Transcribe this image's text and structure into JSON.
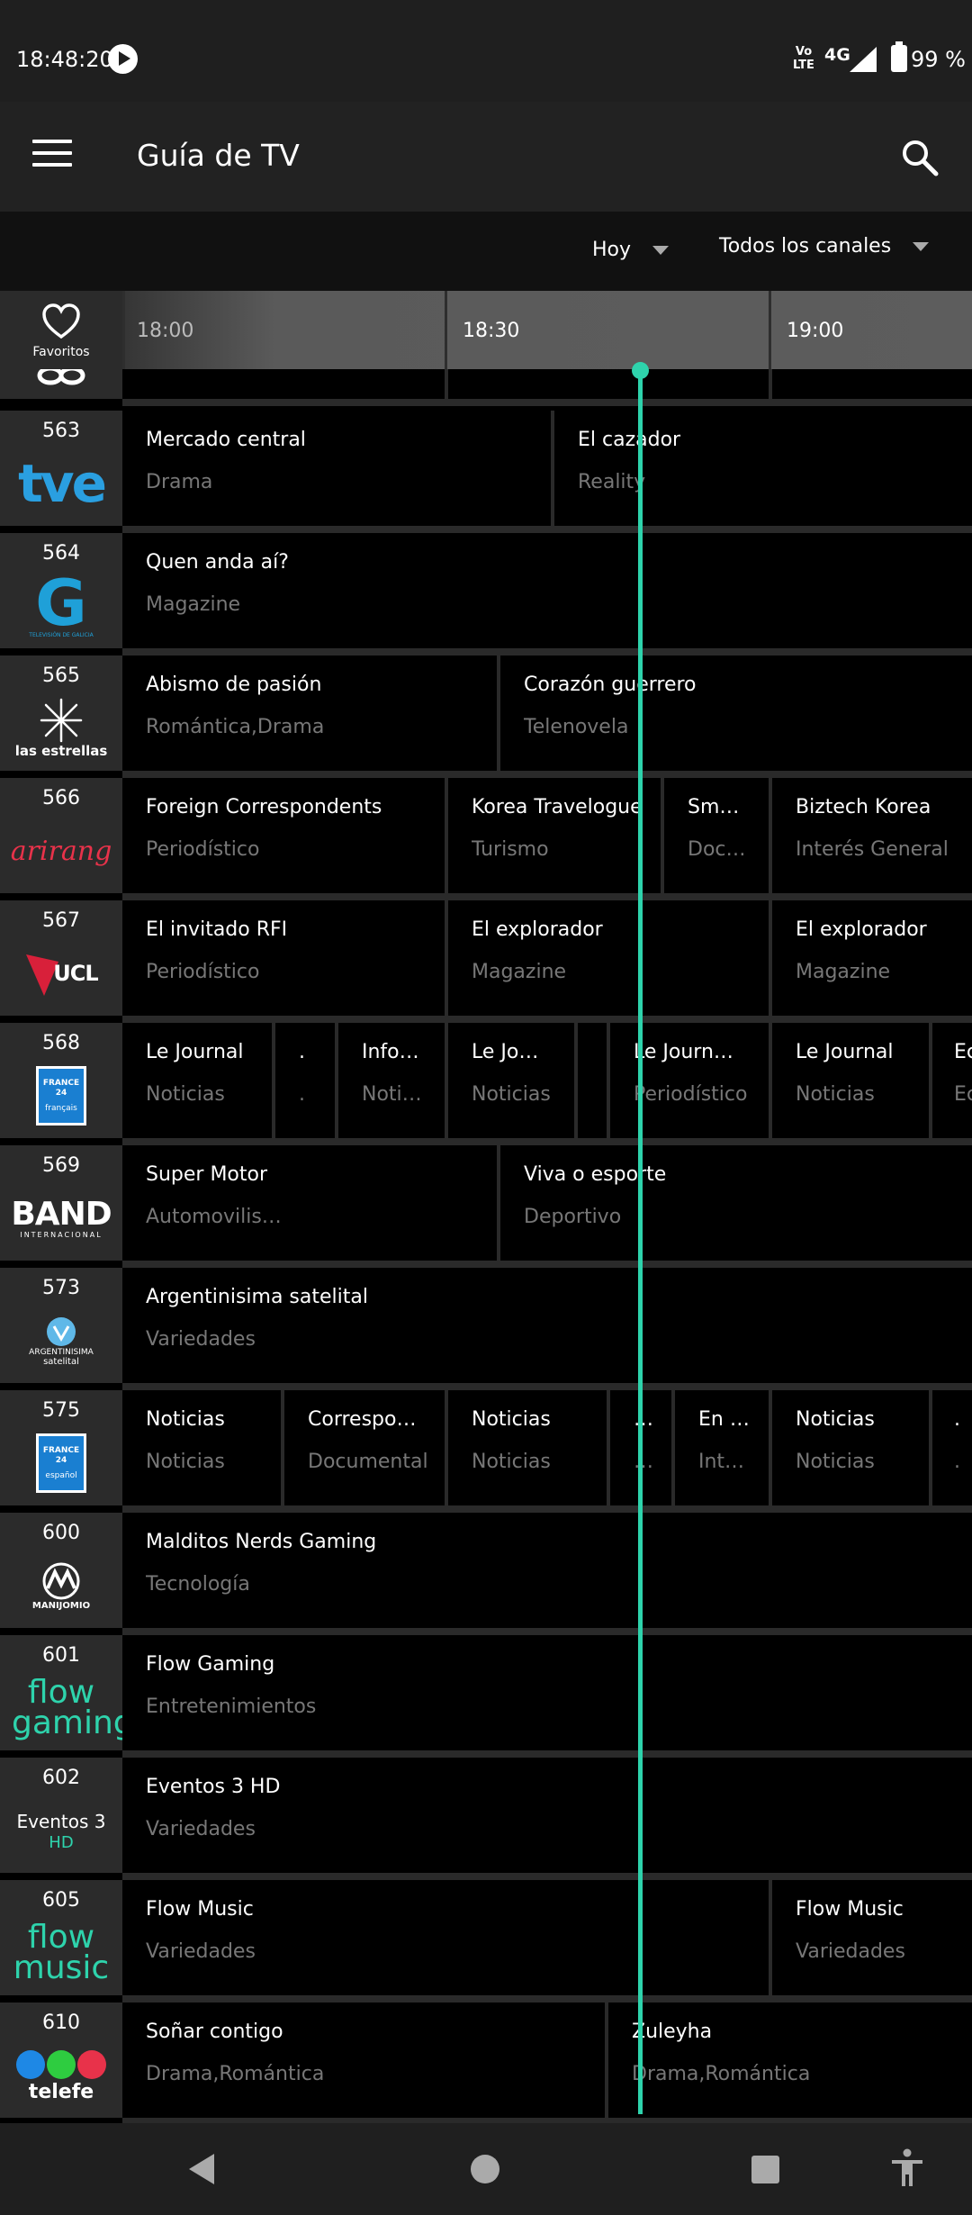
{
  "status_bar": {
    "time": "18:48:20",
    "volte": "Vo LTE",
    "network": "4G",
    "battery": "99 %"
  },
  "app_bar": {
    "title": "Guía de TV"
  },
  "filters": {
    "day": "Hoy",
    "channels": "Todos los canales"
  },
  "ruler": {
    "favorites_label": "Favoritos",
    "ticks": [
      "18:00",
      "18:30",
      "19:00"
    ]
  },
  "channels": [
    {
      "number": "563",
      "logo": "tve",
      "programs": [
        {
          "title": "Mercado central",
          "genre": "Drama"
        },
        {
          "title": "El cazador",
          "genre": "Reality"
        }
      ]
    },
    {
      "number": "564",
      "logo": "G",
      "logo_sub": "TELEVISIÓN DE GALICIA",
      "programs": [
        {
          "title": "Quen anda aí?",
          "genre": "Magazine"
        }
      ]
    },
    {
      "number": "565",
      "logo": "las estrellas",
      "programs": [
        {
          "title": "Abismo de pasión",
          "genre": "Romántica,Drama"
        },
        {
          "title": "Corazón guerrero",
          "genre": "Telenovela"
        }
      ]
    },
    {
      "number": "566",
      "logo": "arirang",
      "programs": [
        {
          "title": "Foreign Correspondents",
          "genre": "Periodístico"
        },
        {
          "title": "Korea Travelogue",
          "genre": "Turismo"
        },
        {
          "title": "Sm…",
          "genre": "Doc…"
        },
        {
          "title": "Biztech Korea",
          "genre": "Interés General"
        }
      ]
    },
    {
      "number": "567",
      "logo": "UCL",
      "programs": [
        {
          "title": "El invitado RFI",
          "genre": "Periodístico"
        },
        {
          "title": "El explorador",
          "genre": "Magazine"
        },
        {
          "title": "El explorador",
          "genre": "Magazine"
        }
      ]
    },
    {
      "number": "568",
      "logo": "FRANCE 24",
      "logo_sub": "français",
      "programs": [
        {
          "title": "Le Journal",
          "genre": "Noticias"
        },
        {
          "title": ".",
          "genre": "."
        },
        {
          "title": "Info…",
          "genre": "Noti…"
        },
        {
          "title": "Le Jo…",
          "genre": "Noticias"
        },
        {
          "title": "",
          "genre": ""
        },
        {
          "title": "Le Journ…",
          "genre": "Periodístico"
        },
        {
          "title": "Le Journal",
          "genre": "Noticias"
        },
        {
          "title": "Ec",
          "genre": "Ec"
        }
      ]
    },
    {
      "number": "569",
      "logo": "BAND",
      "logo_sub": "INTERNACIONAL",
      "programs": [
        {
          "title": "Super Motor",
          "genre": "Automovilis…"
        },
        {
          "title": "Viva o esporte",
          "genre": "Deportivo"
        }
      ]
    },
    {
      "number": "573",
      "logo": "ARGENTINISIMA",
      "logo_sub": "satelital",
      "programs": [
        {
          "title": "Argentinisima satelital",
          "genre": "Variedades"
        }
      ]
    },
    {
      "number": "575",
      "logo": "FRANCE 24",
      "logo_sub": "español",
      "programs": [
        {
          "title": "Noticias",
          "genre": "Noticias"
        },
        {
          "title": "Correspo…",
          "genre": "Documental"
        },
        {
          "title": "Noticias",
          "genre": "Noticias"
        },
        {
          "title": "…",
          "genre": "…"
        },
        {
          "title": "En …",
          "genre": "Int…"
        },
        {
          "title": "Noticias",
          "genre": "Noticias"
        },
        {
          "title": ".",
          "genre": "."
        }
      ]
    },
    {
      "number": "600",
      "logo": "MANIJOMIO",
      "programs": [
        {
          "title": "Malditos Nerds Gaming",
          "genre": "Tecnología"
        }
      ]
    },
    {
      "number": "601",
      "logo": "flow gaming",
      "programs": [
        {
          "title": "Flow Gaming",
          "genre": "Entretenimientos"
        }
      ]
    },
    {
      "number": "602",
      "logo": "Eventos 3",
      "logo_sub": "HD",
      "programs": [
        {
          "title": "Eventos 3 HD",
          "genre": "Variedades"
        }
      ]
    },
    {
      "number": "605",
      "logo": "flow music",
      "programs": [
        {
          "title": "Flow Music",
          "genre": "Variedades"
        },
        {
          "title": "Flow Music",
          "genre": "Variedades"
        }
      ]
    },
    {
      "number": "610",
      "logo": "telefe",
      "programs": [
        {
          "title": "Soñar contigo",
          "genre": "Drama,Romántica"
        },
        {
          "title": "Zuleyha",
          "genre": "Drama,Romántica"
        }
      ]
    }
  ],
  "colors": {
    "accent": "#2ed3ac",
    "background": "#000000",
    "channel_cell": "#2b2b2b"
  }
}
